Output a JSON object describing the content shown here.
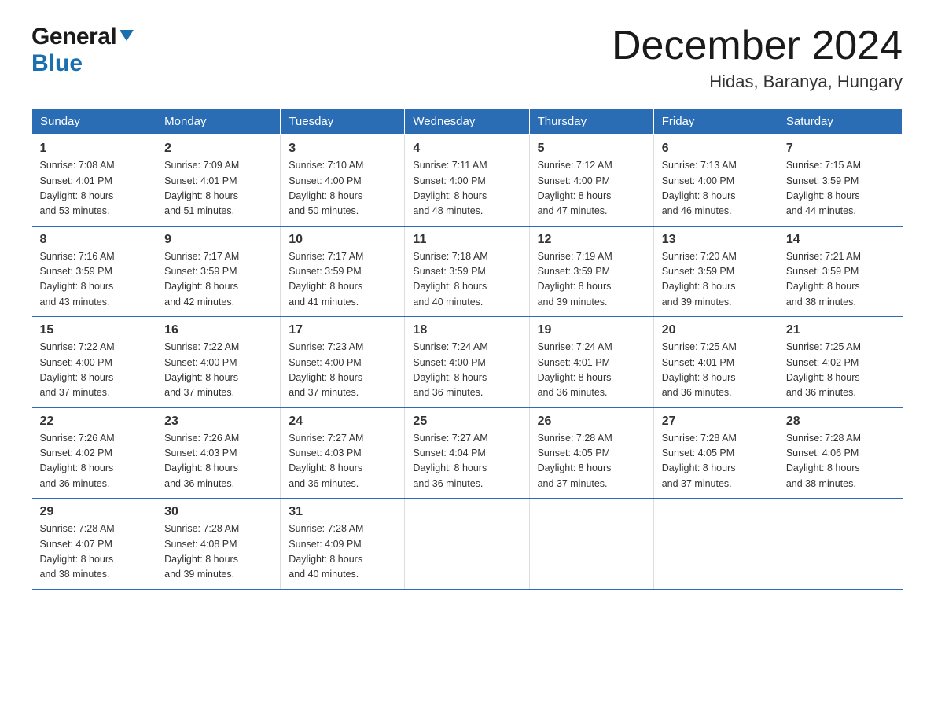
{
  "header": {
    "logo_general": "General",
    "logo_blue": "Blue",
    "month_title": "December 2024",
    "location": "Hidas, Baranya, Hungary"
  },
  "calendar": {
    "days_of_week": [
      "Sunday",
      "Monday",
      "Tuesday",
      "Wednesday",
      "Thursday",
      "Friday",
      "Saturday"
    ],
    "weeks": [
      [
        {
          "day": "1",
          "sunrise": "7:08 AM",
          "sunset": "4:01 PM",
          "daylight": "8 hours and 53 minutes."
        },
        {
          "day": "2",
          "sunrise": "7:09 AM",
          "sunset": "4:01 PM",
          "daylight": "8 hours and 51 minutes."
        },
        {
          "day": "3",
          "sunrise": "7:10 AM",
          "sunset": "4:00 PM",
          "daylight": "8 hours and 50 minutes."
        },
        {
          "day": "4",
          "sunrise": "7:11 AM",
          "sunset": "4:00 PM",
          "daylight": "8 hours and 48 minutes."
        },
        {
          "day": "5",
          "sunrise": "7:12 AM",
          "sunset": "4:00 PM",
          "daylight": "8 hours and 47 minutes."
        },
        {
          "day": "6",
          "sunrise": "7:13 AM",
          "sunset": "4:00 PM",
          "daylight": "8 hours and 46 minutes."
        },
        {
          "day": "7",
          "sunrise": "7:15 AM",
          "sunset": "3:59 PM",
          "daylight": "8 hours and 44 minutes."
        }
      ],
      [
        {
          "day": "8",
          "sunrise": "7:16 AM",
          "sunset": "3:59 PM",
          "daylight": "8 hours and 43 minutes."
        },
        {
          "day": "9",
          "sunrise": "7:17 AM",
          "sunset": "3:59 PM",
          "daylight": "8 hours and 42 minutes."
        },
        {
          "day": "10",
          "sunrise": "7:17 AM",
          "sunset": "3:59 PM",
          "daylight": "8 hours and 41 minutes."
        },
        {
          "day": "11",
          "sunrise": "7:18 AM",
          "sunset": "3:59 PM",
          "daylight": "8 hours and 40 minutes."
        },
        {
          "day": "12",
          "sunrise": "7:19 AM",
          "sunset": "3:59 PM",
          "daylight": "8 hours and 39 minutes."
        },
        {
          "day": "13",
          "sunrise": "7:20 AM",
          "sunset": "3:59 PM",
          "daylight": "8 hours and 39 minutes."
        },
        {
          "day": "14",
          "sunrise": "7:21 AM",
          "sunset": "3:59 PM",
          "daylight": "8 hours and 38 minutes."
        }
      ],
      [
        {
          "day": "15",
          "sunrise": "7:22 AM",
          "sunset": "4:00 PM",
          "daylight": "8 hours and 37 minutes."
        },
        {
          "day": "16",
          "sunrise": "7:22 AM",
          "sunset": "4:00 PM",
          "daylight": "8 hours and 37 minutes."
        },
        {
          "day": "17",
          "sunrise": "7:23 AM",
          "sunset": "4:00 PM",
          "daylight": "8 hours and 37 minutes."
        },
        {
          "day": "18",
          "sunrise": "7:24 AM",
          "sunset": "4:00 PM",
          "daylight": "8 hours and 36 minutes."
        },
        {
          "day": "19",
          "sunrise": "7:24 AM",
          "sunset": "4:01 PM",
          "daylight": "8 hours and 36 minutes."
        },
        {
          "day": "20",
          "sunrise": "7:25 AM",
          "sunset": "4:01 PM",
          "daylight": "8 hours and 36 minutes."
        },
        {
          "day": "21",
          "sunrise": "7:25 AM",
          "sunset": "4:02 PM",
          "daylight": "8 hours and 36 minutes."
        }
      ],
      [
        {
          "day": "22",
          "sunrise": "7:26 AM",
          "sunset": "4:02 PM",
          "daylight": "8 hours and 36 minutes."
        },
        {
          "day": "23",
          "sunrise": "7:26 AM",
          "sunset": "4:03 PM",
          "daylight": "8 hours and 36 minutes."
        },
        {
          "day": "24",
          "sunrise": "7:27 AM",
          "sunset": "4:03 PM",
          "daylight": "8 hours and 36 minutes."
        },
        {
          "day": "25",
          "sunrise": "7:27 AM",
          "sunset": "4:04 PM",
          "daylight": "8 hours and 36 minutes."
        },
        {
          "day": "26",
          "sunrise": "7:28 AM",
          "sunset": "4:05 PM",
          "daylight": "8 hours and 37 minutes."
        },
        {
          "day": "27",
          "sunrise": "7:28 AM",
          "sunset": "4:05 PM",
          "daylight": "8 hours and 37 minutes."
        },
        {
          "day": "28",
          "sunrise": "7:28 AM",
          "sunset": "4:06 PM",
          "daylight": "8 hours and 38 minutes."
        }
      ],
      [
        {
          "day": "29",
          "sunrise": "7:28 AM",
          "sunset": "4:07 PM",
          "daylight": "8 hours and 38 minutes."
        },
        {
          "day": "30",
          "sunrise": "7:28 AM",
          "sunset": "4:08 PM",
          "daylight": "8 hours and 39 minutes."
        },
        {
          "day": "31",
          "sunrise": "7:28 AM",
          "sunset": "4:09 PM",
          "daylight": "8 hours and 40 minutes."
        },
        null,
        null,
        null,
        null
      ]
    ],
    "labels": {
      "sunrise": "Sunrise:",
      "sunset": "Sunset:",
      "daylight": "Daylight:"
    }
  }
}
